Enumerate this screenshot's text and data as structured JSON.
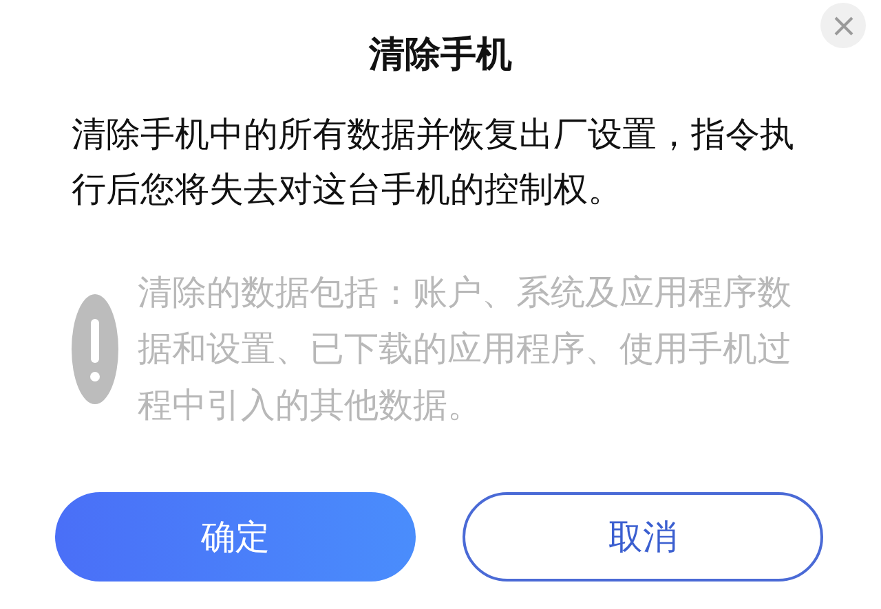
{
  "dialog": {
    "title": "清除手机",
    "message": "清除手机中的所有数据并恢复出厂设置，指令执行后您将失去对这台手机的控制权。",
    "notice": "清除的数据包括：账户、系统及应用程序数据和设置、已下载的应用程序、使用手机过程中引入的其他数据。",
    "buttons": [
      {
        "label": "确定",
        "kind": "primary"
      },
      {
        "label": "取消",
        "kind": "secondary"
      }
    ]
  }
}
